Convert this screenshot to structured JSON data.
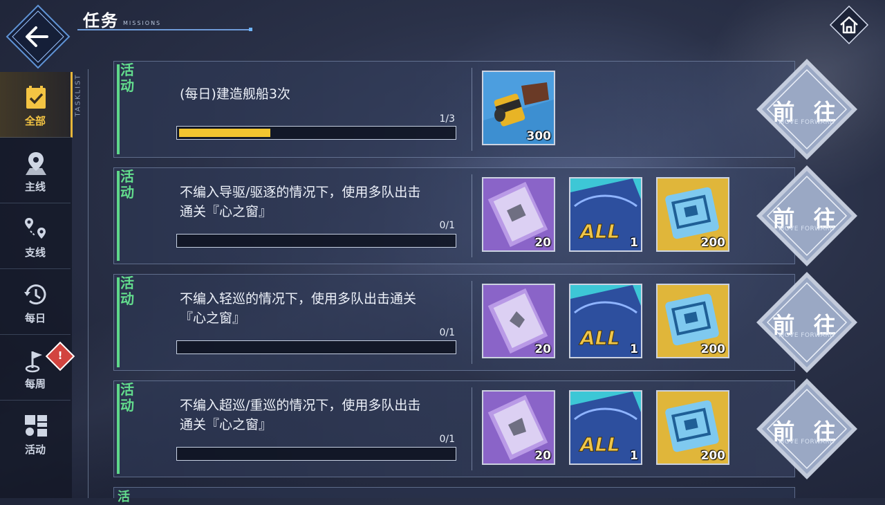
{
  "header": {
    "title": "任务",
    "subtitle": "MISSIONS"
  },
  "tasklist_label": "TASKLIST",
  "sidebar": {
    "items": [
      {
        "label": "全部",
        "icon": "clipboard-check-icon"
      },
      {
        "label": "主线",
        "icon": "map-pin-icon"
      },
      {
        "label": "支线",
        "icon": "route-icon"
      },
      {
        "label": "每日",
        "icon": "history-clock-icon"
      },
      {
        "label": "每周",
        "icon": "flag-icon"
      },
      {
        "label": "活动",
        "icon": "grid-tiles-icon"
      }
    ],
    "weekly_badge": "!"
  },
  "missions": [
    {
      "category": "活动",
      "text": "(每日)建造舰船3次",
      "progress_text": "1/3",
      "progress": 0.333,
      "rewards": [
        {
          "type": "film-roll",
          "qty": "300"
        }
      ],
      "go_label": "前 往",
      "go_sub": "MOVE FORWARD"
    },
    {
      "category": "活动",
      "text": "不编入导驱/驱逐的情况下，使用多队出击通关『心之窗』",
      "progress_text": "0/1",
      "progress": 0,
      "rewards": [
        {
          "type": "purple-book",
          "qty": "20"
        },
        {
          "type": "all-ticket",
          "qty": "1"
        },
        {
          "type": "gold-chip",
          "qty": "200"
        }
      ],
      "go_label": "前 往",
      "go_sub": "MOVE FORWARD"
    },
    {
      "category": "活动",
      "text": "不编入轻巡的情况下，使用多队出击通关『心之窗』",
      "progress_text": "0/1",
      "progress": 0,
      "rewards": [
        {
          "type": "purple-book",
          "qty": "20"
        },
        {
          "type": "all-ticket",
          "qty": "1"
        },
        {
          "type": "gold-chip",
          "qty": "200"
        }
      ],
      "go_label": "前 往",
      "go_sub": "MOVE FORWARD"
    },
    {
      "category": "活动",
      "text": "不编入超巡/重巡的情况下，使用多队出击通关『心之窗』",
      "progress_text": "0/1",
      "progress": 0,
      "rewards": [
        {
          "type": "purple-book",
          "qty": "20"
        },
        {
          "type": "all-ticket",
          "qty": "1"
        },
        {
          "type": "gold-chip",
          "qty": "200"
        }
      ],
      "go_label": "前 往",
      "go_sub": "MOVE FORWARD"
    }
  ],
  "partial_category": "活"
}
